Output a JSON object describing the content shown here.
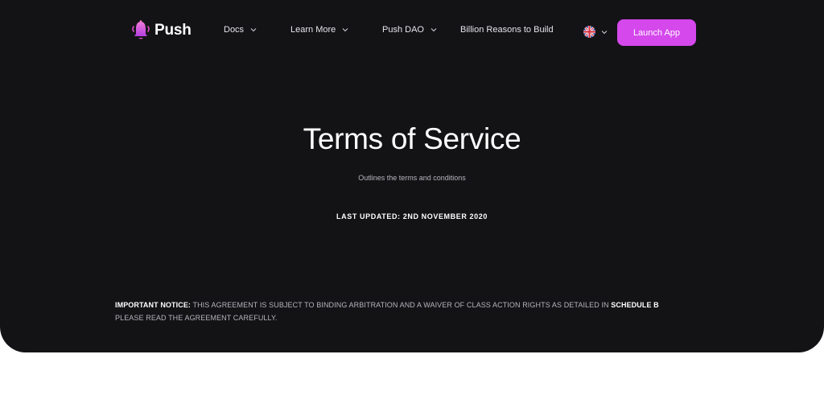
{
  "header": {
    "logo_text": "Push",
    "nav": [
      {
        "label": "Docs",
        "has_dropdown": true
      },
      {
        "label": "Learn More",
        "has_dropdown": true
      },
      {
        "label": "Push DAO",
        "has_dropdown": true
      },
      {
        "label": "Billion Reasons to Build",
        "has_dropdown": false
      }
    ],
    "language_icon": "uk-flag-icon",
    "launch_label": "Launch App"
  },
  "hero": {
    "title": "Terms of Service",
    "subtitle": "Outlines the terms and conditions",
    "last_updated": "LAST UPDATED: 2ND NOVEMBER 2020"
  },
  "notice": {
    "label": "IMPORTANT NOTICE:",
    "text": "THIS AGREEMENT IS SUBJECT TO BINDING ARBITRATION AND A WAIVER OF CLASS ACTION RIGHTS AS DETAILED IN",
    "link": "SCHEDULE B",
    "line2": "PLEASE READ THE AGREEMENT CAREFULLY."
  },
  "colors": {
    "background": "#131316",
    "accent": "#d548ec",
    "page": "#ffffff"
  }
}
